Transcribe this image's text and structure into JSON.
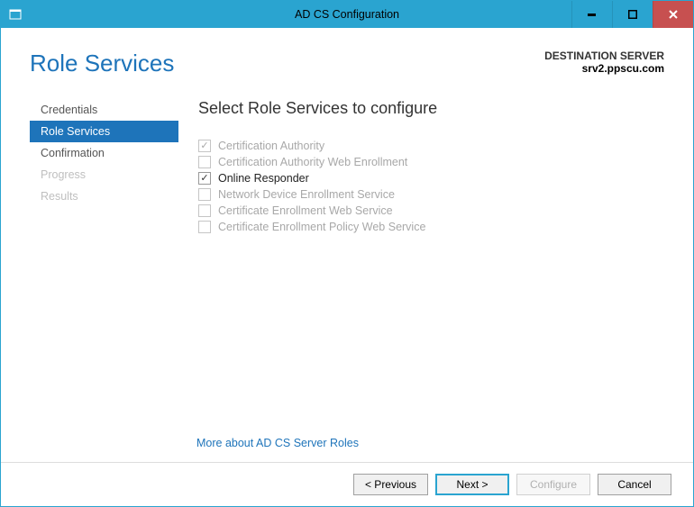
{
  "window": {
    "title": "AD CS Configuration"
  },
  "header": {
    "page_title": "Role Services",
    "destination_label": "DESTINATION SERVER",
    "destination_server": "srv2.ppscu.com"
  },
  "sidebar": {
    "items": [
      {
        "label": "Credentials",
        "state": "normal"
      },
      {
        "label": "Role Services",
        "state": "active"
      },
      {
        "label": "Confirmation",
        "state": "normal"
      },
      {
        "label": "Progress",
        "state": "disabled"
      },
      {
        "label": "Results",
        "state": "disabled"
      }
    ]
  },
  "main": {
    "heading": "Select Role Services to configure",
    "roles": [
      {
        "label": "Certification Authority",
        "checked": true,
        "enabled": false
      },
      {
        "label": "Certification Authority Web Enrollment",
        "checked": false,
        "enabled": false
      },
      {
        "label": "Online Responder",
        "checked": true,
        "enabled": true
      },
      {
        "label": "Network Device Enrollment Service",
        "checked": false,
        "enabled": false
      },
      {
        "label": "Certificate Enrollment Web Service",
        "checked": false,
        "enabled": false
      },
      {
        "label": "Certificate Enrollment Policy Web Service",
        "checked": false,
        "enabled": false
      }
    ],
    "more_link": "More about AD CS Server Roles"
  },
  "footer": {
    "previous": "< Previous",
    "next": "Next >",
    "configure": "Configure",
    "cancel": "Cancel"
  }
}
